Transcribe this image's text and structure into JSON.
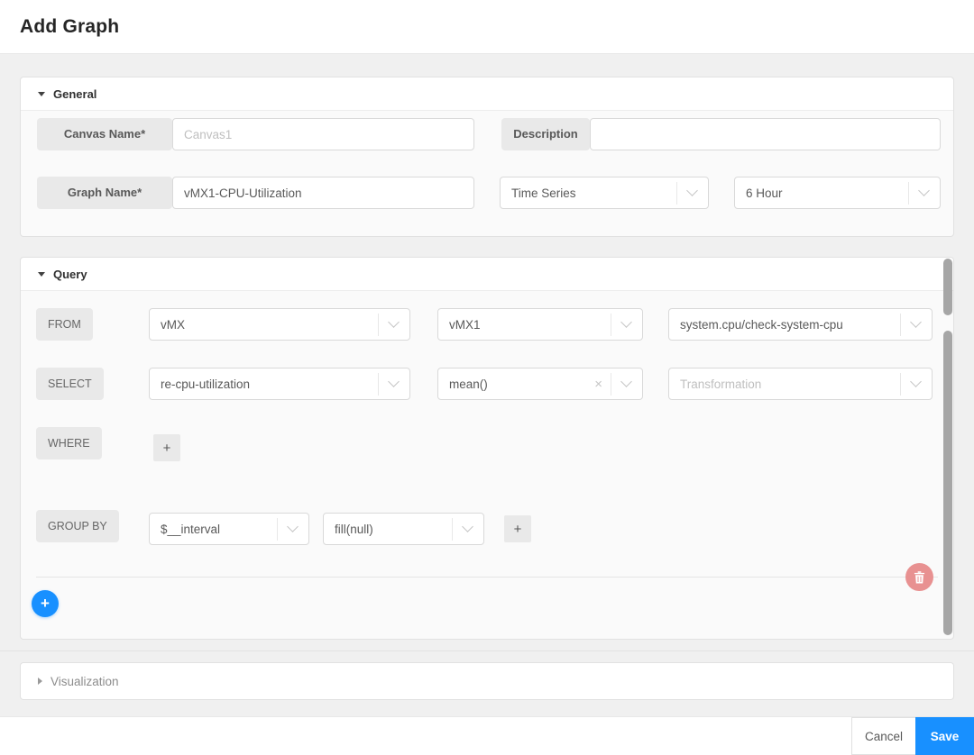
{
  "page": {
    "title": "Add Graph"
  },
  "general": {
    "title": "General",
    "canvas_name_label": "Canvas Name*",
    "canvas_name_placeholder": "Canvas1",
    "description_label": "Description",
    "graph_name_label": "Graph Name*",
    "graph_name_value": "vMX1-CPU-Utilization",
    "graph_type_value": "Time Series",
    "time_range_value": "6 Hour"
  },
  "query": {
    "title": "Query",
    "from_label": "FROM",
    "from_device_type": "vMX",
    "from_device": "vMX1",
    "from_measurement": "system.cpu/check-system-cpu",
    "select_label": "SELECT",
    "select_field": "re-cpu-utilization",
    "select_aggregation": "mean()",
    "select_clear_icon": "×",
    "select_transformation_placeholder": "Transformation",
    "where_label": "WHERE",
    "where_add_label": "+",
    "group_by_label": "GROUP BY",
    "group_by_interval": "$__interval",
    "group_by_fill": "fill(null)",
    "group_by_add_label": "+",
    "add_query_label": "+"
  },
  "visualization": {
    "title": "Visualization"
  },
  "footer": {
    "cancel_label": "Cancel",
    "save_label": "Save"
  },
  "colors": {
    "accent": "#1890ff",
    "danger": "#e89191"
  }
}
